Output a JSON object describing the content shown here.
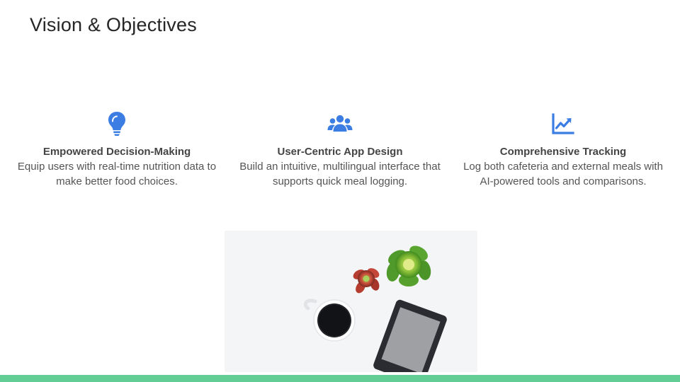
{
  "slide": {
    "title": "Vision & Objectives"
  },
  "columns": [
    {
      "icon": "lightbulb-icon",
      "heading": "Empowered Decision-Making",
      "text": "Equip users with real-time nutrition data to make better food choices."
    },
    {
      "icon": "users-icon",
      "heading": "User-Centric App Design",
      "text": "Build an intuitive, multilingual interface that supports quick meal logging."
    },
    {
      "icon": "chart-line-icon",
      "heading": "Comprehensive Tracking",
      "text": "Log both cafeteria and external meals with AI-powered tools and comparisons."
    }
  ],
  "colors": {
    "accent_blue": "#3b7de3",
    "bottom_bar_green": "#62cd95",
    "title_text": "#262626",
    "body_text": "#555555"
  },
  "image": {
    "content": "desk-photo-succulents-coffee-ereader"
  }
}
